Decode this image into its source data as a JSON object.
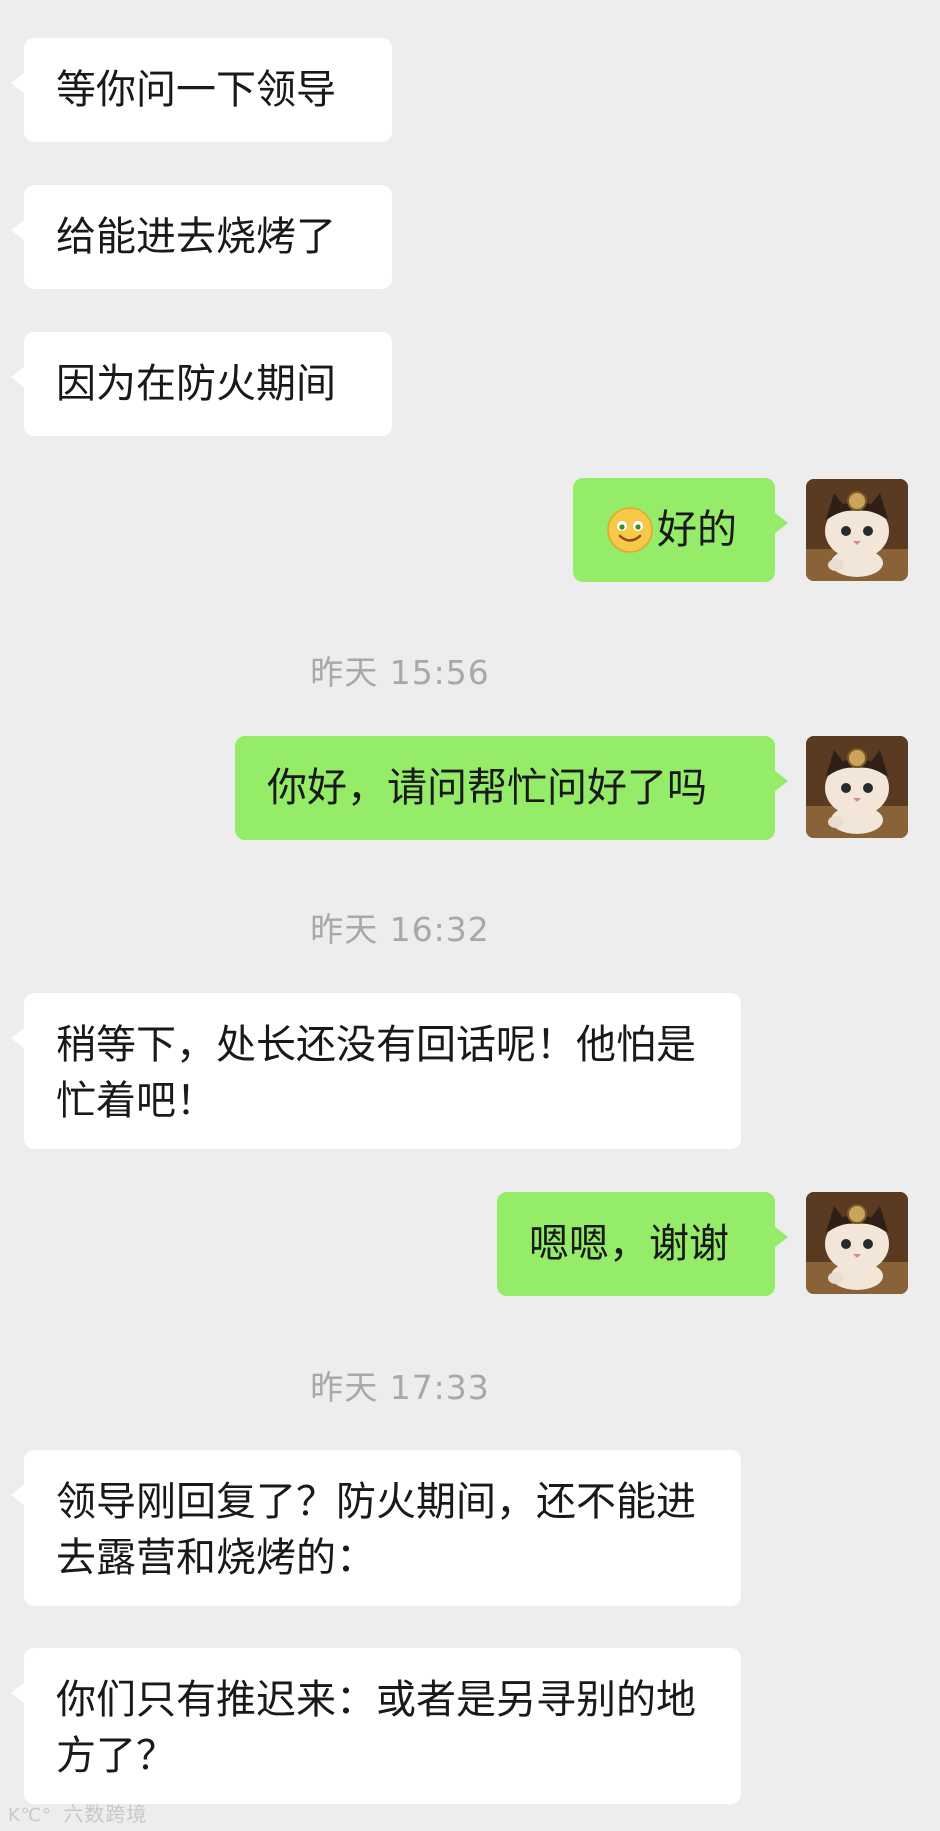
{
  "messages": {
    "m1": "等你问一下领导",
    "m2": "给能进去烧烤了",
    "m3": "因为在防火期间",
    "m4_text": "好的",
    "m4_emoji": "smiling-face-emoji",
    "t1": "昨天 15:56",
    "m5": "你好，请问帮忙问好了吗",
    "t2": "昨天 16:32",
    "m6": "稍等下，处长还没有回话呢！他怕是忙着吧！",
    "m7": "嗯嗯，谢谢",
    "t3": "昨天 17:33",
    "m8": "领导刚回复了？防火期间，还不能进去露营和烧烤的：",
    "m9": "你们只有推迟来：或者是另寻别的地方了？"
  },
  "watermark": {
    "logo": "K℃°",
    "text": "六数跨境"
  },
  "colors": {
    "background": "#ededed",
    "incoming_bubble": "#ffffff",
    "outgoing_bubble": "#95ec69",
    "timestamp": "#a8a8a8"
  },
  "icons": {
    "user_avatar": "cat-avatar-icon"
  }
}
